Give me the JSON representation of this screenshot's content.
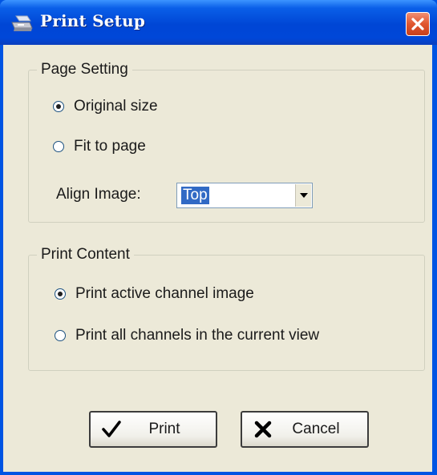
{
  "window": {
    "title": "Print Setup",
    "close_icon": "close-icon"
  },
  "page_setting": {
    "legend": "Page Setting",
    "options": [
      {
        "label": "Original size",
        "checked": true
      },
      {
        "label": "Fit to page",
        "checked": false
      }
    ],
    "align_label": "Align Image:",
    "align_value": "Top"
  },
  "print_content": {
    "legend": "Print Content",
    "options": [
      {
        "label": "Print active channel image",
        "checked": true
      },
      {
        "label": "Print all channels in the current view",
        "checked": false
      }
    ]
  },
  "buttons": {
    "print_label": "Print",
    "cancel_label": "Cancel"
  },
  "colors": {
    "titlebar": "#0046d5",
    "client": "#ece9d8",
    "selection": "#316ac5",
    "close": "#e0562f"
  }
}
